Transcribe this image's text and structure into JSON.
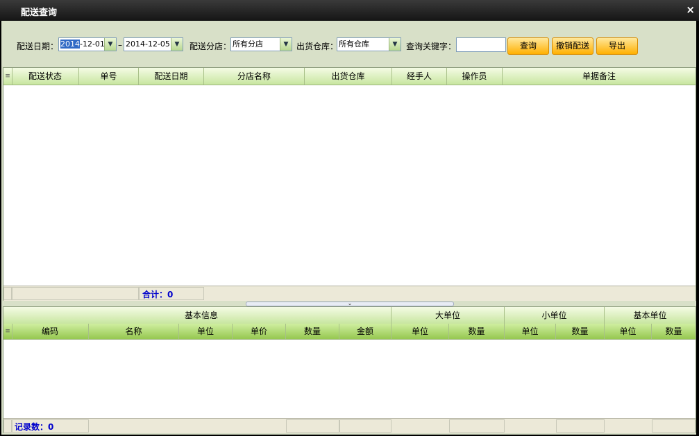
{
  "window": {
    "title": "配送查询",
    "close_label": "×"
  },
  "filters": {
    "date_label": "配送日期：",
    "date_from_sel": "2014",
    "date_from_rest": "-12-01",
    "date_sep": "–",
    "date_to": "2014-12-05",
    "branch_label": "配送分店：",
    "branch_value": "所有分店",
    "warehouse_label": "出货仓库：",
    "warehouse_value": "所有仓库",
    "keyword_label": "查询关键字：",
    "keyword_value": "",
    "query_btn": "查询",
    "cancel_btn": "撤销配送",
    "export_btn": "导出"
  },
  "upper_grid": {
    "row_indicator": "≡",
    "columns": [
      "配送状态",
      "单号",
      "配送日期",
      "分店名称",
      "出货仓库",
      "经手人",
      "操作员",
      "单据备注"
    ],
    "total_label": "合计：0"
  },
  "splitter_arrow": "⌄",
  "lower_grid": {
    "row_indicator": "≡",
    "groups": [
      "基本信息",
      "大单位",
      "小单位",
      "基本单位"
    ],
    "columns": [
      "编码",
      "名称",
      "单位",
      "单价",
      "数量",
      "金额",
      "单位",
      "数量",
      "单位",
      "数量",
      "单位",
      "数量"
    ],
    "record_label": "记录数：0"
  }
}
